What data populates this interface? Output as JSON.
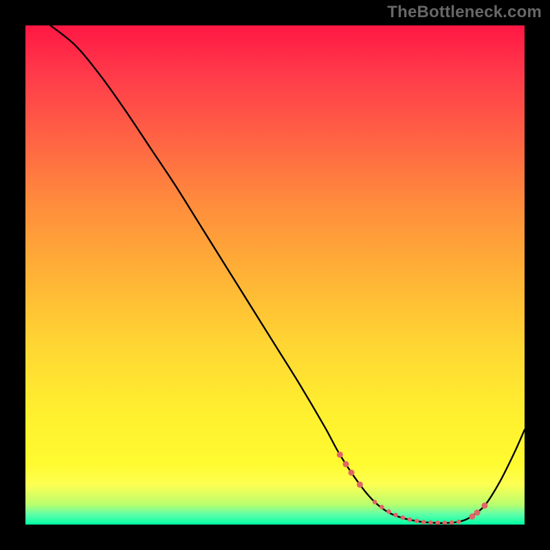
{
  "watermark": "TheBottleneck.com",
  "chart_data": {
    "type": "line",
    "title": "",
    "xlabel": "",
    "ylabel": "",
    "ylim": [
      0,
      100
    ],
    "xlim": [
      0,
      100
    ],
    "series": [
      {
        "name": "bottleneck-curve",
        "x": [
          5,
          10,
          15,
          20,
          25,
          30,
          35,
          40,
          45,
          50,
          55,
          60,
          63,
          67,
          70,
          73,
          76,
          79,
          81,
          83,
          85,
          87,
          89,
          92,
          95,
          98,
          100
        ],
        "y": [
          100,
          96,
          90,
          83,
          75.5,
          68,
          60,
          52,
          44,
          36,
          28,
          19.5,
          14,
          8,
          4.5,
          2.3,
          1.2,
          0.6,
          0.4,
          0.3,
          0.35,
          0.6,
          1.4,
          3.8,
          8.5,
          14.5,
          19
        ],
        "color": "#000000"
      }
    ],
    "markers": {
      "name": "highlight-points",
      "color": "#e06666",
      "radius_large": 4.5,
      "radius_small": 3.3,
      "points": [
        {
          "x": 63.0,
          "y": 14.0,
          "r": "large"
        },
        {
          "x": 64.2,
          "y": 12.1,
          "r": "large"
        },
        {
          "x": 65.3,
          "y": 10.4,
          "r": "large"
        },
        {
          "x": 67.0,
          "y": 8.0,
          "r": "large"
        },
        {
          "x": 70.0,
          "y": 4.5,
          "r": "small"
        },
        {
          "x": 71.4,
          "y": 3.5,
          "r": "small"
        },
        {
          "x": 72.8,
          "y": 2.6,
          "r": "small"
        },
        {
          "x": 74.2,
          "y": 1.9,
          "r": "small"
        },
        {
          "x": 75.6,
          "y": 1.4,
          "r": "small"
        },
        {
          "x": 77.0,
          "y": 1.0,
          "r": "small"
        },
        {
          "x": 78.4,
          "y": 0.7,
          "r": "small"
        },
        {
          "x": 79.8,
          "y": 0.5,
          "r": "small"
        },
        {
          "x": 81.2,
          "y": 0.4,
          "r": "small"
        },
        {
          "x": 82.6,
          "y": 0.35,
          "r": "small"
        },
        {
          "x": 84.0,
          "y": 0.35,
          "r": "small"
        },
        {
          "x": 85.4,
          "y": 0.4,
          "r": "small"
        },
        {
          "x": 86.8,
          "y": 0.55,
          "r": "small"
        },
        {
          "x": 89.5,
          "y": 1.6,
          "r": "large"
        },
        {
          "x": 90.5,
          "y": 2.4,
          "r": "large"
        },
        {
          "x": 92.0,
          "y": 3.8,
          "r": "large"
        }
      ]
    }
  }
}
